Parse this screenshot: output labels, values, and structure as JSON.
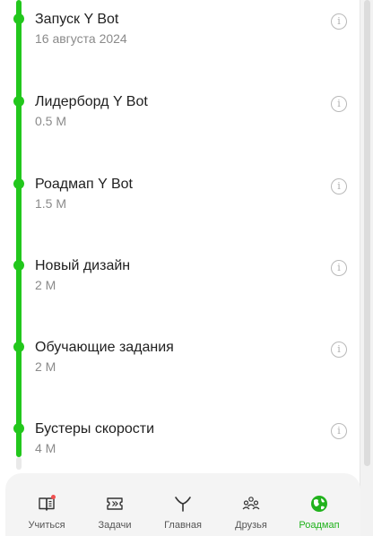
{
  "roadmap": {
    "items": [
      {
        "title": "Запуск Y Bot",
        "subtitle": "16 августа 2024"
      },
      {
        "title": "Лидерборд Y Bot",
        "subtitle": "0.5 M"
      },
      {
        "title": "Роадмап Y Bot",
        "subtitle": "1.5 M"
      },
      {
        "title": "Новый дизайн",
        "subtitle": "2 M"
      },
      {
        "title": "Обучающие задания",
        "subtitle": "2 M"
      },
      {
        "title": "Бустеры скорости",
        "subtitle": "4 M"
      }
    ],
    "info_icon": "info-icon",
    "accent_color": "#22c71c"
  },
  "nav": {
    "items": [
      {
        "label": "Учиться",
        "icon": "book-icon",
        "badge": true
      },
      {
        "label": "Задачи",
        "icon": "ticket-icon"
      },
      {
        "label": "Главная",
        "icon": "y-logo-icon"
      },
      {
        "label": "Друзья",
        "icon": "friends-icon"
      },
      {
        "label": "Роадмап",
        "icon": "globe-icon",
        "active": true
      }
    ],
    "active_color": "#21b21d",
    "badge_color": "#f05050"
  }
}
